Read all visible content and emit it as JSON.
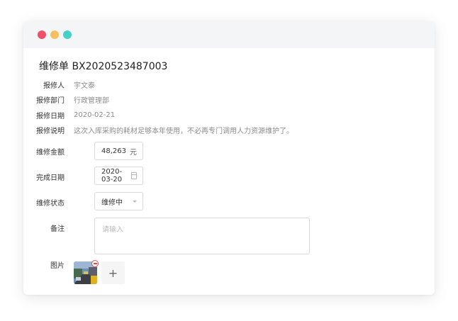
{
  "colors": {
    "dot_red": "#f04f6a",
    "dot_yellow": "#f6bf60",
    "dot_teal": "#43d1c8",
    "danger": "#e8484b"
  },
  "form": {
    "title": "维修单 BX2020523487003",
    "reporter": {
      "label": "报修人",
      "value": "宇文泰"
    },
    "department": {
      "label": "报修部门",
      "value": "行政管理部"
    },
    "report_date": {
      "label": "报修日期",
      "value": "2020-02-21"
    },
    "description": {
      "label": "报修说明",
      "value": "这次入库采购的耗材足够本年使用，不必再专门调用人力资源维护了。"
    },
    "amount": {
      "label": "维修金额",
      "value": "48,263",
      "suffix": "元"
    },
    "finish_date": {
      "label": "完成日期",
      "value": "2020-03-20",
      "icon": "calendar-icon"
    },
    "status": {
      "label": "维修状态",
      "value": "维修中",
      "icon": "chevron-down-icon"
    },
    "remark": {
      "label": "备注",
      "placeholder": "请输入"
    },
    "images": {
      "label": "图片",
      "add_symbol": "+",
      "remove_icon": "minus-circle-icon"
    }
  }
}
